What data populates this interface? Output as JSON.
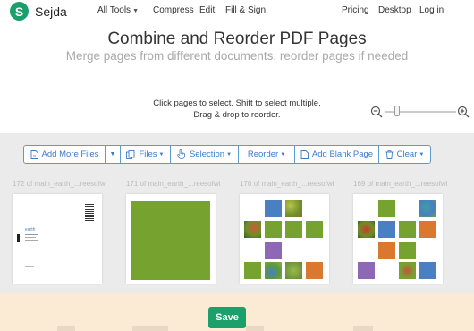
{
  "nav": {
    "logo_letter": "S",
    "brand": "Sejda",
    "all_tools": "All Tools",
    "compress": "Compress",
    "edit": "Edit",
    "fill_sign": "Fill & Sign",
    "pricing": "Pricing",
    "desktop": "Desktop",
    "login": "Log in"
  },
  "hero": {
    "title": "Combine and Reorder PDF Pages",
    "subtitle": "Merge pages from different documents, reorder pages if needed",
    "hint_line1": "Click pages to select. Shift to select multiple.",
    "hint_line2": "Drag & drop to reorder."
  },
  "zoom": {
    "level_fraction": 0.15
  },
  "toolbar": {
    "add_more_files": "Add More Files",
    "files": "Files",
    "selection": "Selection",
    "reorder": "Reorder",
    "add_blank_page": "Add Blank Page",
    "clear": "Clear"
  },
  "pages": [
    {
      "label": "172 of main_earth_...reesofwi...",
      "kind": "cover",
      "cover_text": "earth"
    },
    {
      "label": "171 of main_earth_...reesofwi...",
      "kind": "green"
    },
    {
      "label": "170 of main_earth_...reesofwi...",
      "kind": "grid-a"
    },
    {
      "label": "169 of main_earth_...reesofwi...",
      "kind": "grid-b"
    }
  ],
  "save": {
    "label": "Save"
  },
  "colors": {
    "brand_green": "#1a9e6b",
    "accent_blue": "#3a7bc8",
    "page_green": "#76a32f",
    "tile_blue": "#4a7fc1",
    "tile_purple": "#8e67b5",
    "tile_orange": "#d9782e",
    "save_bar": "#fcebd4"
  }
}
